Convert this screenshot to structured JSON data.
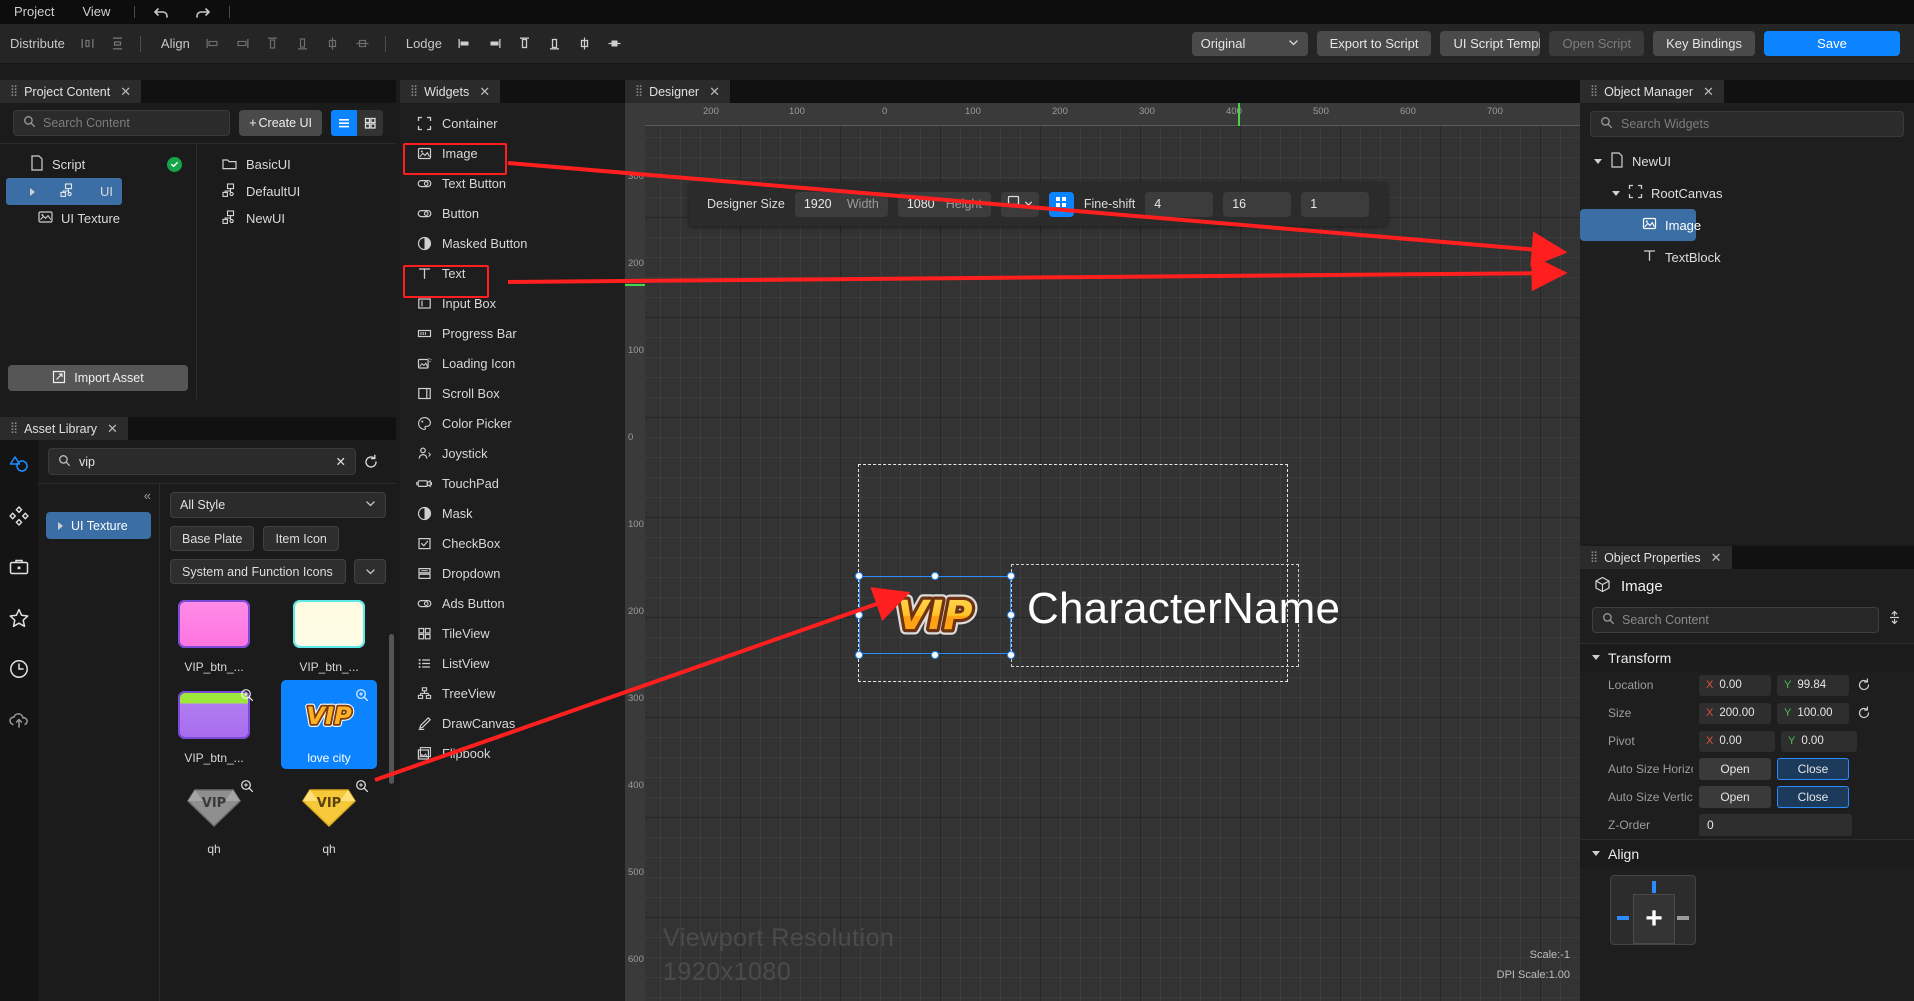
{
  "menu": {
    "items": [
      "Project",
      "View"
    ],
    "undo_icon": "undo-icon",
    "redo_icon": "redo-icon"
  },
  "toolbar": {
    "distribute_label": "Distribute",
    "align_label": "Align",
    "lodge_label": "Lodge",
    "mode_select": "Original",
    "export_to_script": "Export to Script",
    "ui_script_template": "UI Script Templat",
    "open_script": "Open Script",
    "key_bindings": "Key Bindings",
    "save": "Save",
    "accent_color": "#0c84ff"
  },
  "project_content": {
    "tab_title": "Project Content",
    "search_placeholder": "Search Content",
    "create_ui_label": "Create UI",
    "tree": [
      {
        "label": "Script",
        "icon": "file-icon",
        "selected": false,
        "status": "ok"
      },
      {
        "label": "UI",
        "icon": "ui-node-icon",
        "selected": true
      },
      {
        "label": "UI Texture",
        "icon": "texture-icon",
        "selected": false
      }
    ],
    "list": [
      {
        "label": "BasicUI",
        "icon": "folder-icon"
      },
      {
        "label": "DefaultUI",
        "icon": "ui-node-icon"
      },
      {
        "label": "NewUI",
        "icon": "ui-node-icon"
      }
    ],
    "import_asset": "Import Asset"
  },
  "asset_library": {
    "tab_title": "Asset Library",
    "search_value": "vip",
    "rail_icons": [
      "shapes-icon",
      "diamond-grid-icon",
      "briefcase-icon",
      "star-icon",
      "clock-icon",
      "cloud-upload-icon"
    ],
    "category": "UI Texture",
    "style_dropdown": "All Style",
    "chips": [
      "Base Plate",
      "Item Icon"
    ],
    "chip_wide": "System and Function Icons",
    "assets": [
      {
        "name": "VIP_btn_...",
        "swatch": "pink",
        "selected": false
      },
      {
        "name": "VIP_btn_...",
        "swatch": "cream",
        "selected": false
      },
      {
        "name": "VIP_btn_...",
        "swatch": "green-purple",
        "selected": false
      },
      {
        "name": "love city",
        "swatch": "vip-logo",
        "selected": true
      },
      {
        "name": "qh",
        "swatch": "gray-gem",
        "selected": false
      },
      {
        "name": "qh",
        "swatch": "gold-gem",
        "selected": false
      }
    ]
  },
  "widgets": {
    "tab_title": "Widgets",
    "items": [
      {
        "label": "Container",
        "icon": "container-icon",
        "highlighted": false
      },
      {
        "label": "Image",
        "icon": "image-icon",
        "highlighted": true
      },
      {
        "label": "Text Button",
        "icon": "text-button-icon",
        "highlighted": false
      },
      {
        "label": "Button",
        "icon": "button-icon",
        "highlighted": false
      },
      {
        "label": "Masked Button",
        "icon": "masked-button-icon",
        "highlighted": false
      },
      {
        "label": "Text",
        "icon": "text-icon",
        "highlighted": true
      },
      {
        "label": "Input Box",
        "icon": "input-box-icon",
        "highlighted": false
      },
      {
        "label": "Progress Bar",
        "icon": "progress-bar-icon",
        "highlighted": false
      },
      {
        "label": "Loading Icon",
        "icon": "loading-icon",
        "highlighted": false
      },
      {
        "label": "Scroll Box",
        "icon": "scroll-box-icon",
        "highlighted": false
      },
      {
        "label": "Color Picker",
        "icon": "color-picker-icon",
        "highlighted": false
      },
      {
        "label": "Joystick",
        "icon": "joystick-icon",
        "highlighted": false
      },
      {
        "label": "TouchPad",
        "icon": "touchpad-icon",
        "highlighted": false
      },
      {
        "label": "Mask",
        "icon": "mask-icon",
        "highlighted": false
      },
      {
        "label": "CheckBox",
        "icon": "checkbox-icon",
        "highlighted": false
      },
      {
        "label": "Dropdown",
        "icon": "dropdown-icon",
        "highlighted": false
      },
      {
        "label": "Ads Button",
        "icon": "ads-button-icon",
        "highlighted": false
      },
      {
        "label": "TileView",
        "icon": "tileview-icon",
        "highlighted": false
      },
      {
        "label": "ListView",
        "icon": "listview-icon",
        "highlighted": false
      },
      {
        "label": "TreeView",
        "icon": "treeview-icon",
        "highlighted": false
      },
      {
        "label": "DrawCanvas",
        "icon": "drawcanvas-icon",
        "highlighted": false
      },
      {
        "label": "Flipbook",
        "icon": "flipbook-icon",
        "highlighted": false
      }
    ]
  },
  "designer": {
    "tab_title": "Designer",
    "size_bar": {
      "label": "Designer Size",
      "width_value": "1920",
      "width_unit": "Width",
      "height_value": "1080",
      "height_unit": "Height",
      "device_icon": "monitor-icon",
      "grid_icon": "grid-icon",
      "fine_shift_label": "Fine-shift",
      "fine_shift_1": "4",
      "fine_shift_2": "16",
      "fine_shift_3": "1"
    },
    "ruler_h_ticks": [
      "200",
      "100",
      "0",
      "100",
      "200",
      "300",
      "400",
      "500",
      "600",
      "700"
    ],
    "ruler_v_ticks": [
      "300",
      "200",
      "100",
      "0",
      "100",
      "200",
      "300",
      "400",
      "500",
      "600"
    ],
    "viewport_label_line1": "Viewport Resolution",
    "viewport_label_line2": "1920x1080",
    "scale_info": "Scale:-1",
    "dpi_info": "DPI Scale:1.00",
    "canvas_text": "CharacterName",
    "canvas_image_alt": "VIP"
  },
  "object_manager": {
    "tab_title": "Object Manager",
    "search_placeholder": "Search Widgets",
    "tree": [
      {
        "label": "NewUI",
        "icon": "file-icon",
        "depth": 0,
        "selected": false,
        "expanded": true
      },
      {
        "label": "RootCanvas",
        "icon": "container-icon",
        "depth": 1,
        "selected": false,
        "expanded": true
      },
      {
        "label": "Image",
        "icon": "image-icon",
        "depth": 2,
        "selected": true
      },
      {
        "label": "TextBlock",
        "icon": "text-icon",
        "depth": 2,
        "selected": false
      }
    ]
  },
  "object_properties": {
    "tab_title": "Object Properties",
    "object_name": "Image",
    "search_placeholder": "Search Content",
    "sections": {
      "transform_label": "Transform",
      "align_label": "Align"
    },
    "rows": {
      "location_label": "Location",
      "location_x": "0.00",
      "location_y": "99.84",
      "size_label": "Size",
      "size_x": "200.00",
      "size_y": "100.00",
      "pivot_label": "Pivot",
      "pivot_x": "0.00",
      "pivot_y": "0.00",
      "auto_size_h_label": "Auto Size Horizo",
      "auto_size_v_label": "Auto Size Vertic",
      "open_label": "Open",
      "close_label": "Close",
      "z_order_label": "Z-Order",
      "z_order_value": "0"
    }
  }
}
